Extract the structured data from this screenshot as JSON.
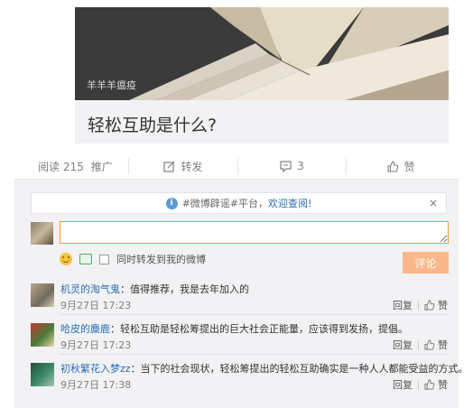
{
  "article": {
    "cover_credit": "羊羊羊瘟疫",
    "title": "轻松互助是什么?"
  },
  "toolbar": {
    "read_label": "阅读 215",
    "promote_label": "推广",
    "repost_label": "转发",
    "comment_count": "3",
    "like_label": "赞"
  },
  "panel": {
    "notice_prefix": "#微博辟谣#平台，",
    "notice_link": "欢迎查阅!",
    "notice_close": "×",
    "input_value": "",
    "repost_option": "同时转发到我的微博",
    "submit_label": "评论"
  },
  "comments": [
    {
      "user": "机灵的淘气鬼",
      "text": "：值得推荐，我是去年加入的",
      "time": "9月27日 17:23",
      "reply": "回复",
      "like": "赞"
    },
    {
      "user": "哈皮的麋鹿",
      "text": "：轻松互助是轻松筹提出的巨大社会正能量，应该得到发扬，提倡。",
      "time": "9月27日 17:23",
      "reply": "回复",
      "like": "赞"
    },
    {
      "user": "初秋繁花入梦zz",
      "text": "：当下的社会现状，轻松筹提出的轻松互助确实是一种人人都能受益的方式。",
      "time": "9月27日 17:38",
      "reply": "回复",
      "like": "赞"
    }
  ]
}
